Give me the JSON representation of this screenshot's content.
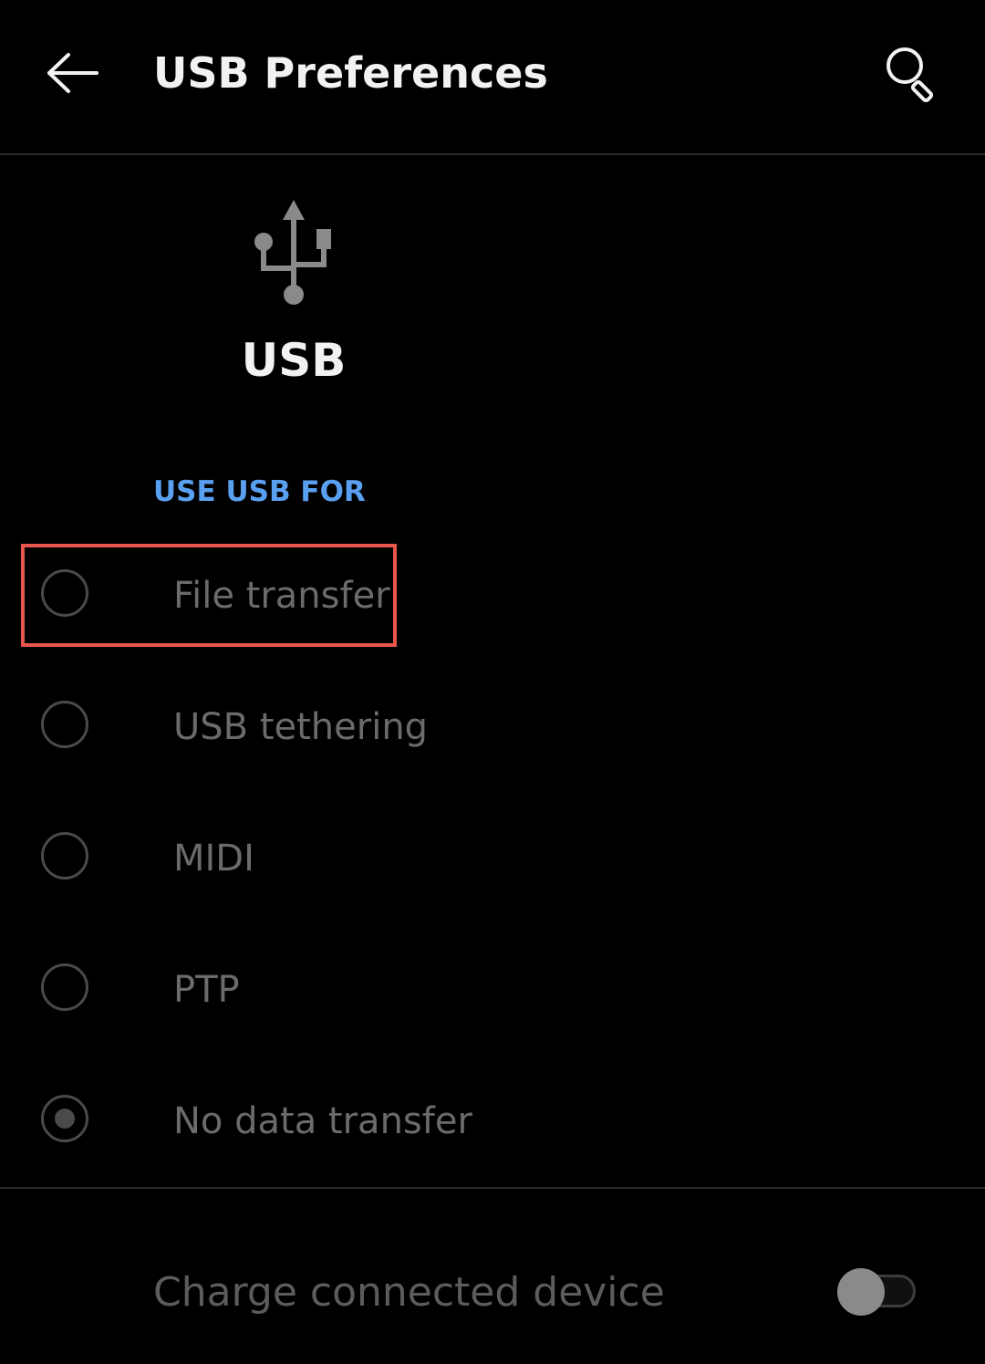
{
  "app_bar": {
    "title": "USB Preferences",
    "back_icon": "arrow-left-icon",
    "search_icon": "search-icon"
  },
  "header": {
    "icon": "usb-icon",
    "label": "USB"
  },
  "section": {
    "label": "USE USB FOR"
  },
  "options": [
    {
      "label": "File transfer",
      "selected": false,
      "highlighted": true
    },
    {
      "label": "USB tethering",
      "selected": false
    },
    {
      "label": "MIDI",
      "selected": false
    },
    {
      "label": "PTP",
      "selected": false
    },
    {
      "label": "No data transfer",
      "selected": true
    }
  ],
  "charge": {
    "label": "Charge connected device",
    "enabled": false
  },
  "colors": {
    "background": "#000000",
    "accent": "#5aa0f0",
    "highlight": "#e8564d",
    "disabled_text": "#6b6b6b"
  }
}
